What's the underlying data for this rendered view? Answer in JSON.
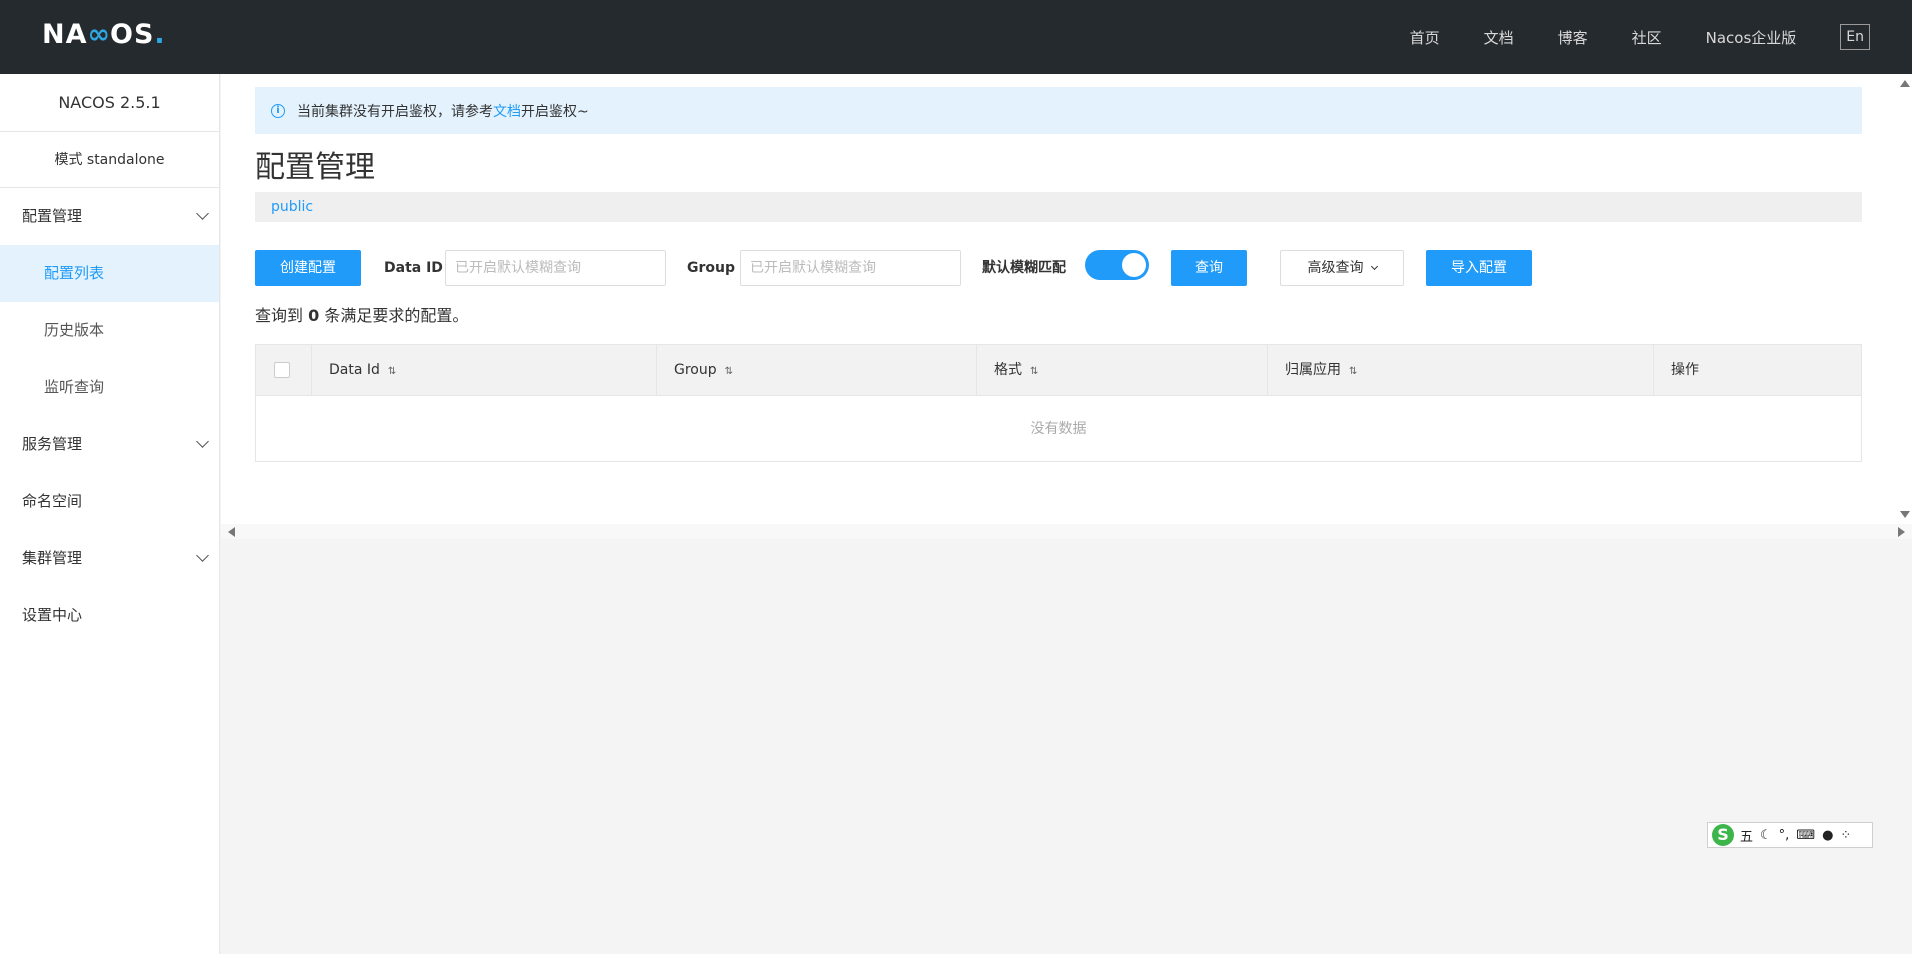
{
  "header": {
    "logo_text_1": "NA",
    "logo_text_2": "OS",
    "logo_dot": ".",
    "nav": [
      "首页",
      "文档",
      "博客",
      "社区",
      "Nacos企业版"
    ],
    "lang": "En"
  },
  "sidebar": {
    "version": "NACOS 2.5.1",
    "mode": "模式 standalone",
    "groups": {
      "config": "配置管理",
      "config_items": [
        "配置列表",
        "历史版本",
        "监听查询"
      ],
      "service": "服务管理",
      "namespace": "命名空间",
      "cluster": "集群管理",
      "settings": "设置中心"
    }
  },
  "notice": {
    "text_before": "当前集群没有开启鉴权，请参考",
    "link": "文档",
    "text_after": "开启鉴权~"
  },
  "page_title": "配置管理",
  "namespace": "public",
  "toolbar": {
    "create_label": "创建配置",
    "data_id_label": "Data ID",
    "data_id_placeholder": "已开启默认模糊查询",
    "group_label": "Group",
    "group_placeholder": "已开启默认模糊查询",
    "fuzzy_label": "默认模糊匹配",
    "fuzzy_enabled": true,
    "query_label": "查询",
    "advanced_label": "高级查询",
    "import_label": "导入配置"
  },
  "result": {
    "prefix": "查询到",
    "count": "0",
    "suffix": "条满足要求的配置。"
  },
  "table": {
    "columns": [
      "Data Id",
      "Group",
      "格式",
      "归属应用",
      "操作"
    ],
    "sort_glyph": "⇅",
    "empty": "没有数据"
  },
  "ime": {
    "logo": "S",
    "mode": "五",
    "icons": [
      "moon-icon",
      "punctuation-icon",
      "keyboard-icon",
      "user-icon",
      "grid-icon"
    ],
    "punct": "°,"
  }
}
